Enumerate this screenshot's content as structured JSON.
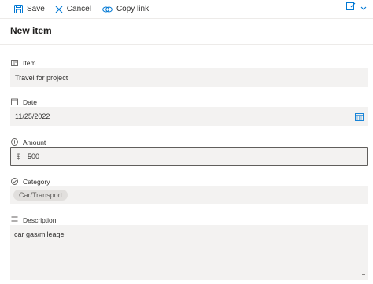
{
  "toolbar": {
    "save_label": "Save",
    "cancel_label": "Cancel",
    "copy_link_label": "Copy link"
  },
  "form": {
    "title": "New item",
    "fields": {
      "item": {
        "label": "Item",
        "value": "Travel for project"
      },
      "date": {
        "label": "Date",
        "value": "11/25/2022"
      },
      "amount": {
        "label": "Amount",
        "currency": "$",
        "value": "500"
      },
      "category": {
        "label": "Category",
        "value": "Car/Transport"
      },
      "description": {
        "label": "Description",
        "value": "car gas/mileage"
      }
    }
  },
  "colors": {
    "accent": "#0078d4",
    "field_background": "#f3f2f1",
    "divider": "#edebe9",
    "text": "#323130"
  },
  "icons": {
    "save": "save-icon",
    "cancel": "close-icon",
    "copy_link": "link-icon",
    "edit_view": "edit-form-icon",
    "chevron": "chevron-down-icon",
    "item": "text-field-icon",
    "date": "calendar-icon",
    "amount": "number-icon",
    "category": "choice-icon",
    "description": "multiline-text-icon"
  }
}
